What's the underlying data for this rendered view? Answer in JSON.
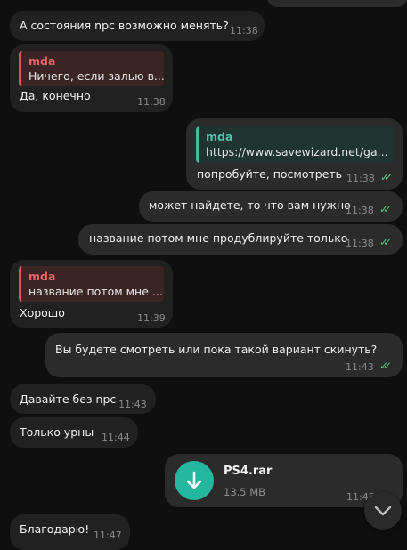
{
  "messages": [
    {
      "text": "А состояния npc возможно менять?",
      "time": "11:38"
    },
    {
      "reply_name": "mda",
      "reply_text": "Ничего, если залью в...",
      "text": "Да, конечно",
      "time": "11:38"
    },
    {
      "reply_name": "mda",
      "reply_text": "https://www.savewizard.net/ga...",
      "text": "попробуйте, посмотреть",
      "time": "11:38"
    },
    {
      "text": "может найдете, то что вам нужно",
      "time": "11:38"
    },
    {
      "text": "название потом мне продублируйте только",
      "time": "11:38"
    },
    {
      "reply_name": "mda",
      "reply_text": "название потом мне ...",
      "text": "Хорошо",
      "time": "11:39"
    },
    {
      "text": "Вы будете смотреть или пока такой вариант скинуть?",
      "time": "11:43"
    },
    {
      "text": "Давайте без npc",
      "time": "11:43"
    },
    {
      "text": "Только урны",
      "time": "11:44"
    },
    {
      "file_name": "PS4.rar",
      "file_size": "13.5 MB",
      "time": "11:45"
    },
    {
      "text": "Благодарю!",
      "time": "11:47"
    }
  ],
  "icons": {
    "read_status": "double-check-icon",
    "file": "download-arrow-icon",
    "scroll": "chevron-down-icon"
  },
  "colors": {
    "background": "#0f0f0f",
    "incoming_bubble": "#212121",
    "outgoing_bubble": "#2b2b2b",
    "read_check": "#4cc38a",
    "file_button": "#24b7a0",
    "reply_red": "#d8585c",
    "reply_green": "#48b89c"
  }
}
